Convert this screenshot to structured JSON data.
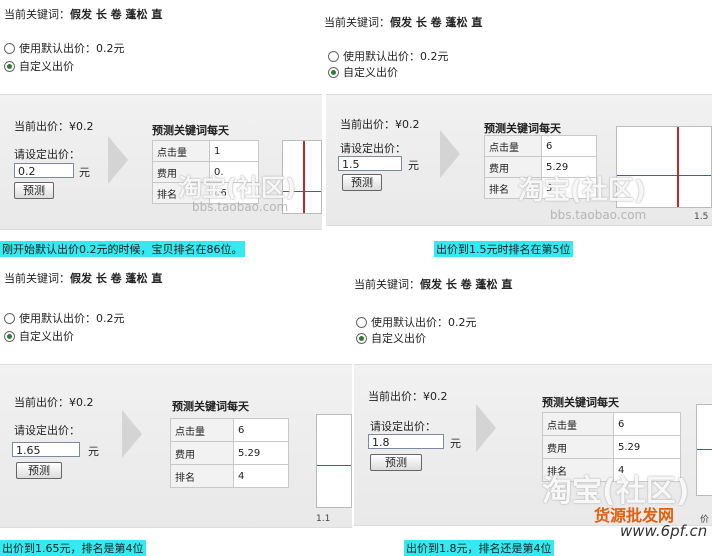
{
  "common": {
    "keyword_label": "当前关键词：",
    "keyword_value": "假发 长 卷 蓬松 直",
    "radio_default": "使用默认出价：0.2元",
    "radio_custom": "自定义出价",
    "current_bid": "当前出价：¥0.2",
    "set_bid": "请设定出价：",
    "unit": "元",
    "predict_btn": "预测",
    "predict_title": "预测关键词每天",
    "row_clicks": "点击量",
    "row_cost": "费用",
    "row_rank": "排名",
    "watermark": "淘宝(社区)",
    "watermark_url": "bbs.taobao.com",
    "brand": "货源批发网",
    "brand_url": "www.6pf.cn"
  },
  "panels": [
    {
      "bid_value": "0.2",
      "clicks": "1",
      "cost": "0.",
      "rank": "86",
      "caption": "刚开始默认出价0.2元的时候，宝贝排名在86位。"
    },
    {
      "bid_value": "1.5",
      "clicks": "6",
      "cost": "5.29",
      "rank": "5",
      "caption": "出价到1.5元时排名在第5位",
      "tick": "1.5"
    },
    {
      "bid_value": "1.65",
      "clicks": "6",
      "cost": "5.29",
      "rank": "4",
      "caption": "出价到1.65元，排名是第4位",
      "tick": "1.1"
    },
    {
      "bid_value": "1.8",
      "clicks": "6",
      "cost": "5.29",
      "rank": "4",
      "caption": "出价到1.8元，排名还是第4位",
      "tick": "价"
    }
  ]
}
